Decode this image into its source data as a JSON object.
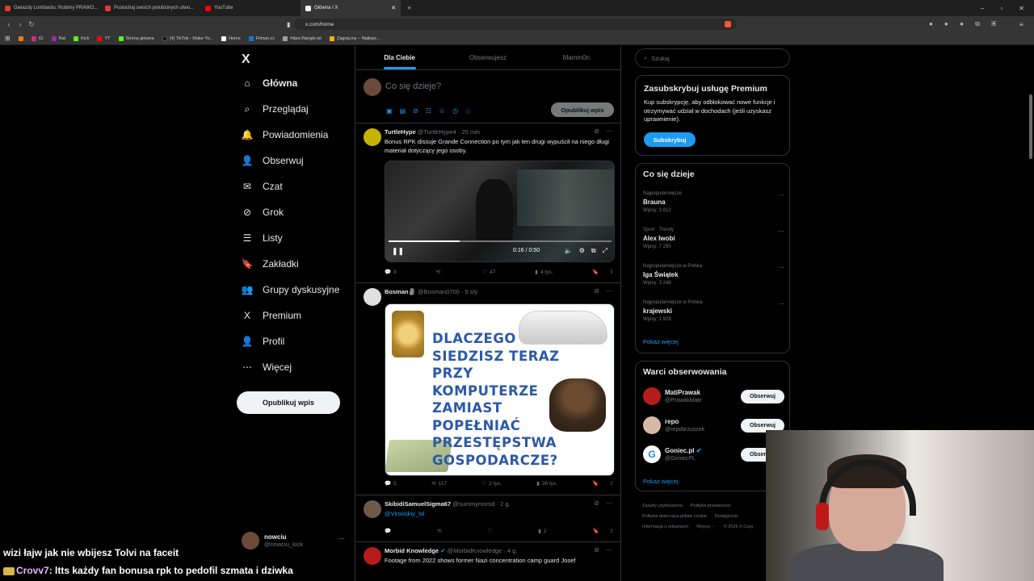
{
  "browser": {
    "tabs": [
      {
        "label": "Gwiazdy Lombardu: Robimy PRAWO...",
        "color": "#e53935"
      },
      {
        "label": "Posłuchaj swoich polubionych utwo...",
        "color": "#e53935"
      },
      {
        "label": "YouTube",
        "color": "#ff0000"
      },
      {
        "label": "Główna / X",
        "color": "#ffffff",
        "active": true
      }
    ],
    "url": "x.com/home",
    "bookmarks": [
      {
        "label": "",
        "color": "#f57c00"
      },
      {
        "label": "IG",
        "color": "#c13584"
      },
      {
        "label": "Rat",
        "color": "#9c27b0"
      },
      {
        "label": "Kick",
        "color": "#53fc18"
      },
      {
        "label": "YT",
        "color": "#ff0000"
      },
      {
        "label": "Strona główna",
        "color": "#53fc18"
      },
      {
        "label": "(4) TikTok - Make Yo...",
        "color": "#111111"
      },
      {
        "label": "Home",
        "color": "#ffffff"
      },
      {
        "label": "Filman.cc",
        "color": "#1976d2"
      },
      {
        "label": "https://tangle.io/",
        "color": "#9e9e9e"
      },
      {
        "label": "Zagraj.my – Najleps...",
        "color": "#ffb300"
      }
    ]
  },
  "nav": {
    "logo": "X",
    "items": [
      {
        "label": "Główna",
        "icon": "house-icon",
        "glyph": "⌂",
        "bold": true
      },
      {
        "label": "Przeglądaj",
        "icon": "search-icon",
        "glyph": "⌕"
      },
      {
        "label": "Powiadomienia",
        "icon": "bell-icon",
        "glyph": "🔔"
      },
      {
        "label": "Obserwuj",
        "icon": "follow-icon",
        "glyph": "👤"
      },
      {
        "label": "Czat",
        "icon": "mail-icon",
        "glyph": "✉"
      },
      {
        "label": "Grok",
        "icon": "grok-icon",
        "glyph": "⊘"
      },
      {
        "label": "Listy",
        "icon": "list-icon",
        "glyph": "☰"
      },
      {
        "label": "Zakładki",
        "icon": "bookmark-icon",
        "glyph": "🔖"
      },
      {
        "label": "Grupy dyskusyjne",
        "icon": "communities-icon",
        "glyph": "👥"
      },
      {
        "label": "Premium",
        "icon": "x-premium-icon",
        "glyph": "X"
      },
      {
        "label": "Profil",
        "icon": "profile-icon",
        "glyph": "👤"
      },
      {
        "label": "Więcej",
        "icon": "more-icon",
        "glyph": "⋯"
      }
    ],
    "post_button": "Opublikuj wpis",
    "user": {
      "name": "nowciu",
      "handle": "@nowciu_kick"
    }
  },
  "feed": {
    "tabs": [
      "Dla Ciebie",
      "Obserwujesz",
      "Mamm0n"
    ],
    "composer": {
      "placeholder": "Co się dzieje?",
      "button": "Opublikuj wpis"
    },
    "tweets": [
      {
        "name": "TurtleHype",
        "handle": "@TurtleHype4",
        "time": "· 25 min",
        "text": "Bonus RPK dissuje Grande Connection po tym jak ten drugi wypuścił na niego długi materiał dotyczący jego osoby.",
        "video": {
          "time": "0:16 / 0:50",
          "progress": 0.32
        },
        "replies": "8",
        "retweets": "",
        "likes": "47",
        "views": "4 tys."
      },
      {
        "name": "Bosman🗿",
        "handle": "@Bosman0700",
        "time": "· 9 sty",
        "image_text": [
          "DLACZEGO",
          "SIEDZISZ TERAZ",
          "PRZY",
          "KOMPUTERZE",
          "ZAMIAST",
          "POPEŁNIAĆ",
          "PRZESTĘPSTWA",
          "GOSPODARCZE?"
        ],
        "replies": "5",
        "retweets": "117",
        "likes": "2 tys.",
        "views": "26 tys."
      },
      {
        "name": "SkibidiSamuelSigma67",
        "handle": "@summymsmd",
        "time": "· 2 g.",
        "text": "@Virooskiy_lol",
        "replies": "",
        "retweets": "",
        "likes": "",
        "views": "2"
      },
      {
        "name": "Morbid Knowledge",
        "handle": "@MorbidKnowledge",
        "time": "· 4 g.",
        "text": "Footage from 2022 shows former Nazi concentration camp guard Josef"
      }
    ]
  },
  "sidebar": {
    "search_placeholder": "Szukaj",
    "premium": {
      "title": "Zasubskrybuj usługę Premium",
      "text": "Kup subskrypcję, aby odblokować nowe funkcje i otrzymywać udział w dochodach (jeśli uzyskasz uprawnienie).",
      "button": "Subskrybuj"
    },
    "trends_title": "Co się dzieje",
    "trends": [
      {
        "meta": "Najpopularniejsze",
        "name": "Brauna",
        "count": "Wpisy: 3 812"
      },
      {
        "meta": "Sport · Trendy",
        "name": "Alex Iwobi",
        "count": "Wpisy: 7 290"
      },
      {
        "meta": "Najpopularniejsze w Polska",
        "name": "Iga Świątek",
        "count": "Wpisy: 3 248"
      },
      {
        "meta": "Najpopularniejsze w Polska",
        "name": "krajewski",
        "count": "Wpisy: 1 929"
      }
    ],
    "show_more": "Pokaż więcej",
    "follow_title": "Warci obserwowania",
    "follow": [
      {
        "name": "MatiPrawak",
        "handle": "@PrawakMatii",
        "color": "#b71c1c"
      },
      {
        "name": "repo",
        "handle": "@repobrzuszek",
        "color": "#d7b9a8"
      },
      {
        "name": "Goniec.pl",
        "handle": "@GoniecPL",
        "color": "#1e88e5",
        "verified": true
      }
    ],
    "follow_button": "Obserwuj",
    "footer": [
      "Zasady użytkowania",
      "Polityka prywatności",
      "Polityka dotycząca plików cookie",
      "Dostępność",
      "Informacja o reklamach",
      "Więcej ···",
      "© 2026 X Corp."
    ]
  },
  "stream_chat": {
    "line1": "wizi łajw jak nie wbijesz Tolvi na faceit",
    "nick": "Crovv7",
    "line2": "ltts każdy fan bonusa rpk to pedofil szmata i dziwka"
  }
}
